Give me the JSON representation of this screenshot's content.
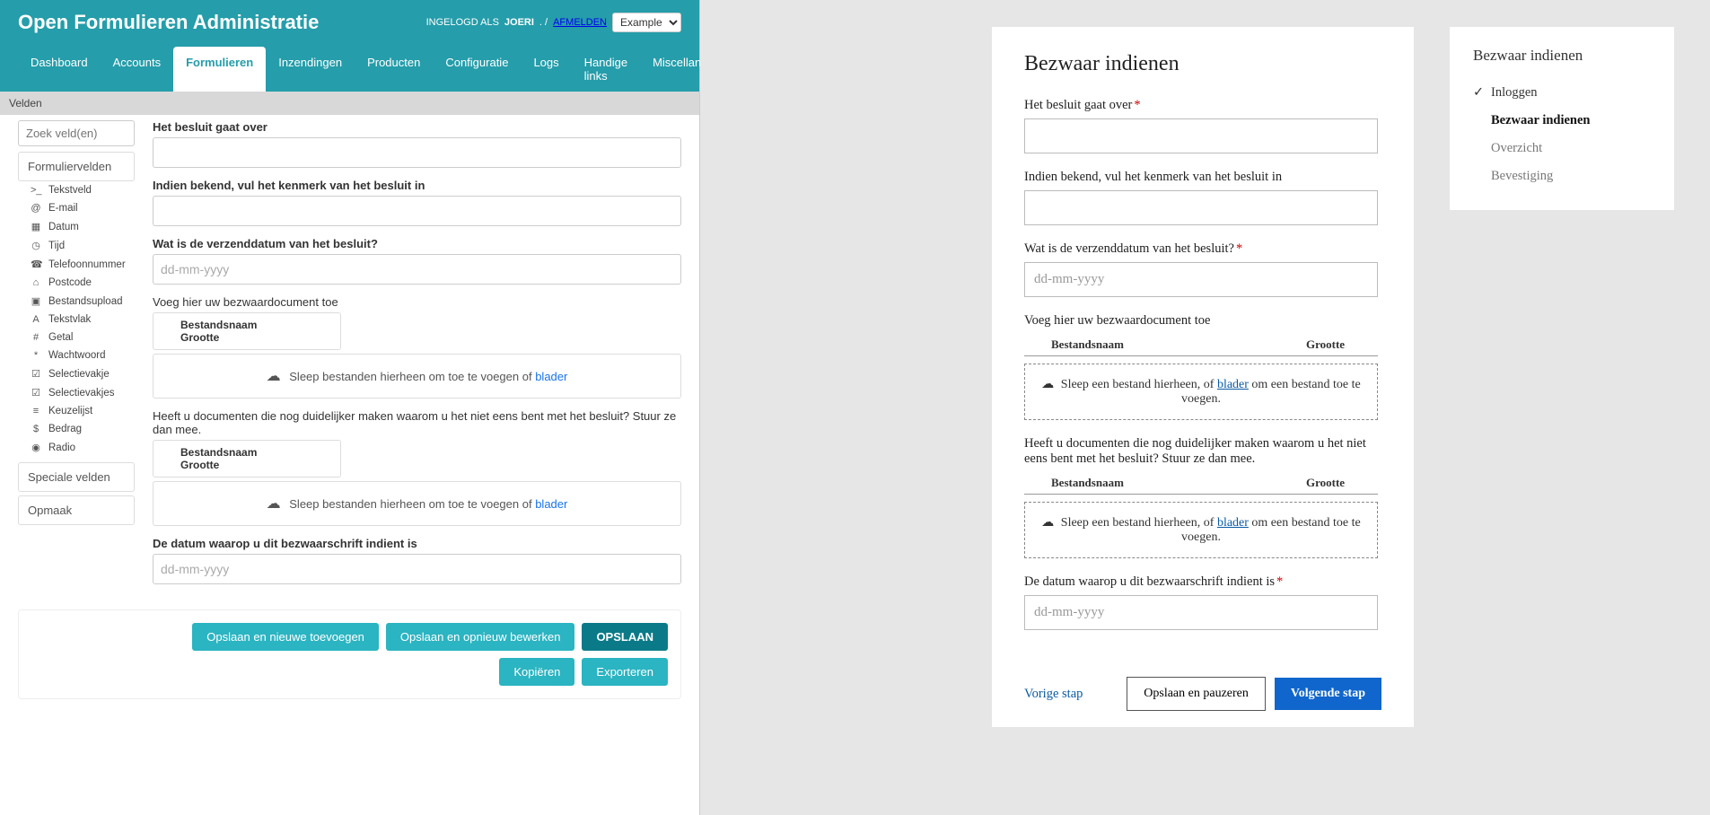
{
  "admin": {
    "title": "Open Formulieren Administratie",
    "logged_prefix": "INGELOGD ALS",
    "username": "JOERI",
    "sep": ".  /",
    "logout": "AFMELDEN",
    "env_selected": "Example",
    "nav": {
      "dashboard": "Dashboard",
      "accounts": "Accounts",
      "formulieren": "Formulieren",
      "inzendingen": "Inzendingen",
      "producten": "Producten",
      "configuratie": "Configuratie",
      "logs": "Logs",
      "handige": "Handige links",
      "misc": "Miscellaneous"
    },
    "section_title": "Velden",
    "search_placeholder": "Zoek veld(en)",
    "group1_title": "Formuliervelden",
    "group2_title": "Speciale velden",
    "group3_title": "Opmaak",
    "fieldtypes": [
      {
        "icon": ">_",
        "label": "Tekstveld"
      },
      {
        "icon": "@",
        "label": "E-mail"
      },
      {
        "icon": "▦",
        "label": "Datum"
      },
      {
        "icon": "◷",
        "label": "Tijd"
      },
      {
        "icon": "☎",
        "label": "Telefoonnummer"
      },
      {
        "icon": "⌂",
        "label": "Postcode"
      },
      {
        "icon": "▣",
        "label": "Bestandsupload"
      },
      {
        "icon": "A",
        "label": "Tekstvlak"
      },
      {
        "icon": "#",
        "label": "Getal"
      },
      {
        "icon": "*",
        "label": "Wachtwoord"
      },
      {
        "icon": "☑",
        "label": "Selectievakje"
      },
      {
        "icon": "☑",
        "label": "Selectievakjes"
      },
      {
        "icon": "≡",
        "label": "Keuzelijst"
      },
      {
        "icon": "$",
        "label": "Bedrag"
      },
      {
        "icon": "◉",
        "label": "Radio"
      }
    ],
    "labels": {
      "f1": "Het besluit gaat over",
      "f2": "Indien bekend, vul het kenmerk van het besluit in",
      "f3": "Wat is de verzenddatum van het besluit?",
      "f4": "Voeg hier uw bezwaardocument toe",
      "f5": "Heeft u documenten die nog duidelijker maken waarom u het niet eens bent met het besluit? Stuur ze dan mee.",
      "f6": "De datum waarop u dit bezwaarschrift indient is"
    },
    "date_placeholder": "dd-mm-yyyy",
    "file_col1": "Bestandsnaam",
    "file_col2": "Grootte",
    "file_drop_text": "Sleep bestanden hierheen om toe te voegen of ",
    "file_drop_link": "blader",
    "buttons": {
      "save_new": "Opslaan en nieuwe toevoegen",
      "save_edit": "Opslaan en opnieuw bewerken",
      "save": "OPSLAAN",
      "copy": "Kopiëren",
      "export": "Exporteren"
    }
  },
  "public": {
    "form_title": "Bezwaar indienen",
    "labels": {
      "f1": "Het besluit gaat over",
      "f2": "Indien bekend, vul het kenmerk van het besluit in",
      "f3": "Wat is de verzenddatum van het besluit?",
      "f4": "Voeg hier uw bezwaardocument toe",
      "f5": "Heeft u documenten die nog duidelijker maken waarom u het niet eens bent met het besluit? Stuur ze dan mee.",
      "f6": "De datum waarop u dit bezwaarschrift indient is"
    },
    "date_placeholder": "dd-mm-yyyy",
    "file_col1": "Bestandsnaam",
    "file_col2": "Grootte",
    "file_drop_pre": "Sleep een bestand hierheen, of ",
    "file_drop_link": "blader",
    "file_drop_post": " om een bestand toe te voegen.",
    "prev": "Vorige stap",
    "pause": "Opslaan en pauzeren",
    "next": "Volgende stap",
    "progress_title": "Bezwaar indienen",
    "steps": {
      "s1": "Inloggen",
      "s2": "Bezwaar indienen",
      "s3": "Overzicht",
      "s4": "Bevestiging"
    }
  }
}
